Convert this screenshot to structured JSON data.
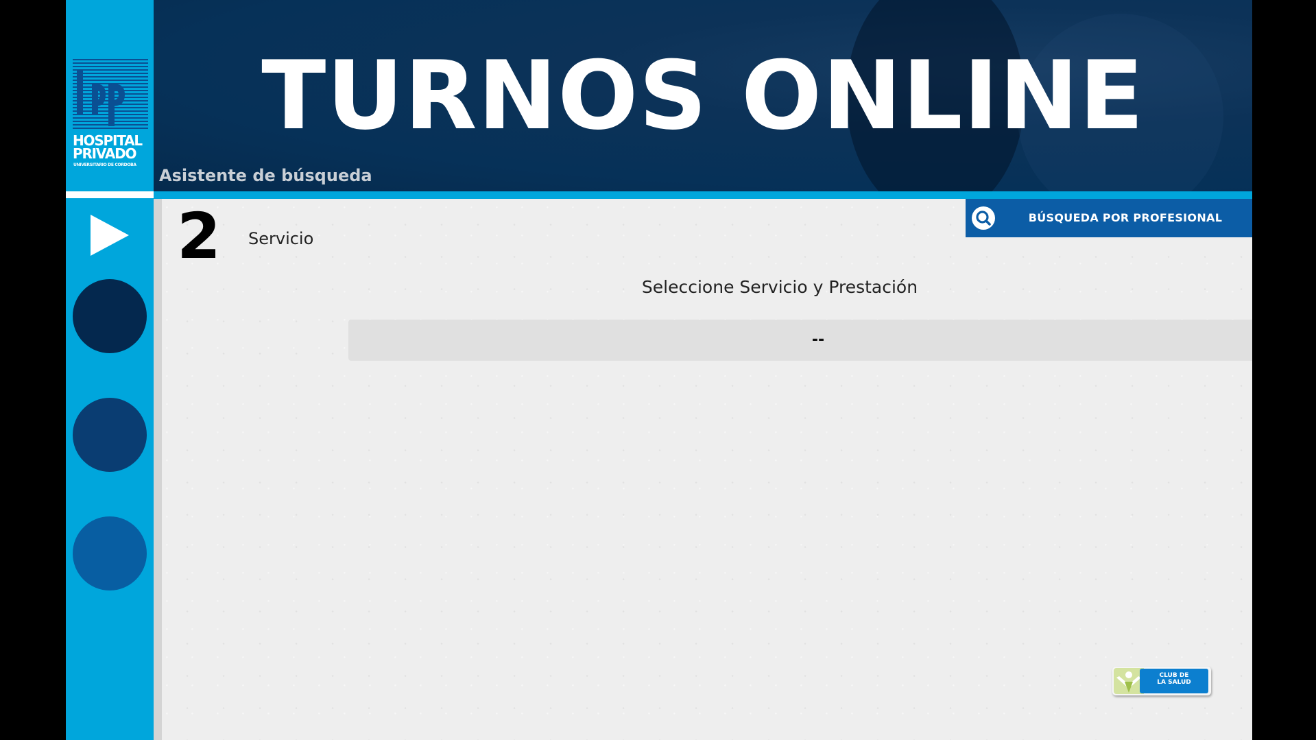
{
  "header": {
    "title": "TURNOS ONLINE",
    "subtitle": "Asistente de búsqueda"
  },
  "logo": {
    "name": "HOSPITAL\nPRIVADO",
    "tagline": "UNIVERSITARIO DE CORDOBA"
  },
  "sidebar": {
    "play_icon": "play-icon",
    "steps": [
      {
        "color": "#04284e"
      },
      {
        "color": "#0a3d72"
      },
      {
        "color": "#085ea2"
      }
    ]
  },
  "step": {
    "number": "2",
    "label": "Servicio"
  },
  "search_professional": {
    "label": "BÚSQUEDA POR PROFESIONAL",
    "icon": "search-icon"
  },
  "form": {
    "heading": "Seleccione Servicio y Prestación",
    "select_value": "--"
  },
  "club_badge": {
    "label": "CLUB DE\nLA SALUD"
  },
  "colors": {
    "accent": "#00a6dc",
    "header_bg": "#063158",
    "button_bg": "#0c5da6",
    "content_bg": "#eeeeee"
  }
}
